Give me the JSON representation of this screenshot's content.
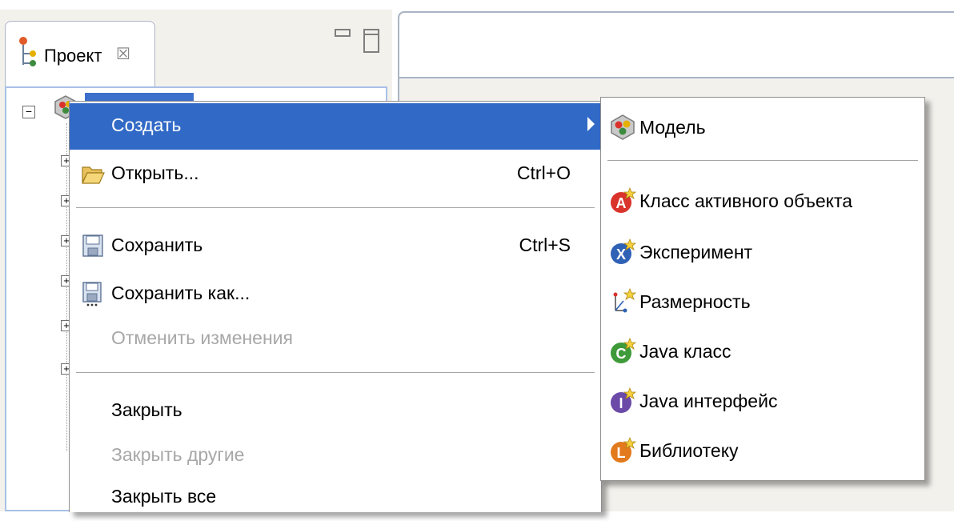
{
  "project_view": {
    "tab_label": "Проект",
    "close_glyph": "☒",
    "tree_collapse_glyph": "−",
    "tree_expand_glyph": "+"
  },
  "context_menu": {
    "items": [
      {
        "label": "Создать",
        "icon": "none",
        "selected": true,
        "has_submenu": true
      },
      {
        "label": "Открыть...",
        "icon": "folder-open-icon",
        "accelerator": "Ctrl+O"
      },
      {
        "label": "Сохранить",
        "icon": "floppy-save-icon",
        "accelerator": "Ctrl+S"
      },
      {
        "label": "Сохранить как...",
        "icon": "floppy-save-as-icon"
      },
      {
        "label": "Отменить изменения",
        "disabled": true
      },
      {
        "label": "Закрыть"
      },
      {
        "label": "Закрыть другие",
        "disabled": true
      },
      {
        "label": "Закрыть все"
      }
    ]
  },
  "submenu": {
    "items": [
      {
        "label": "Модель",
        "icon": "model-icon"
      },
      {
        "label": "Класс активного объекта",
        "icon": "active-object-class-icon",
        "color": "#d9332b",
        "letter": "A"
      },
      {
        "label": "Эксперимент",
        "icon": "experiment-icon",
        "color": "#2f62b5",
        "letter": "X"
      },
      {
        "label": "Размерность",
        "icon": "dimension-icon"
      },
      {
        "label": "Java класс",
        "icon": "java-class-icon",
        "color": "#3f9a3a",
        "letter": "C"
      },
      {
        "label": "Java интерфейс",
        "icon": "java-interface-icon",
        "color": "#6b4aa8",
        "letter": "I"
      },
      {
        "label": "Библиотеку",
        "icon": "library-icon",
        "color": "#e27a1d",
        "letter": "L"
      }
    ]
  },
  "colors": {
    "selection": "#3169c6",
    "disabled_text": "#a7a7a7"
  }
}
